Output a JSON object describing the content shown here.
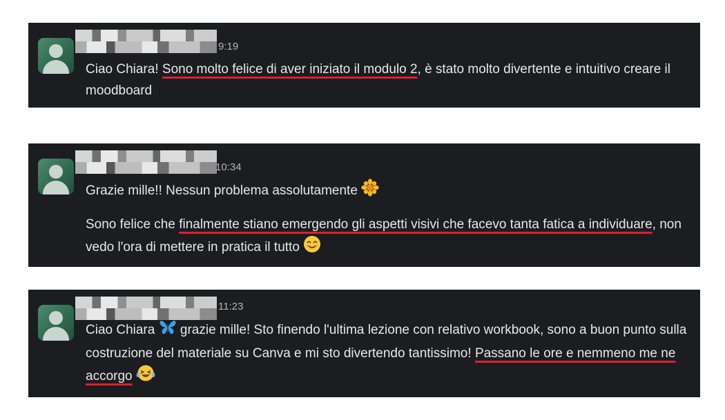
{
  "messages": [
    {
      "time": "9:19",
      "paragraphs": [
        {
          "before": "Ciao Chiara! ",
          "underlined": "Sono molto felice di aver iniziato il modulo 2",
          "after": ", è stato molto divertente e intuitivo creare il moodboard"
        }
      ]
    },
    {
      "time": "10:34",
      "paragraphs": [
        {
          "text": "Grazie mille!! Nessun problema assolutamente",
          "emoji": "flower-emoji"
        },
        {
          "before": "Sono felice che ",
          "underlined": "finalmente stiano emergendo gli aspetti visivi che facevo tanta fatica a individuare",
          "after": ", non vedo l'ora di mettere in pratica il tutto",
          "emoji": "smiling-face-emoji"
        }
      ]
    },
    {
      "time": "11:23",
      "paragraphs": [
        {
          "before": "Ciao Chiara",
          "emoji_inline": "butterfly-emoji",
          "middle": " grazie mille! Sto finendo l'ultima lezione con relativo workbook, sono a buon punto sulla costruzione del materiale su Canva e mi sto divertendo tantissimo! ",
          "underlined": "Passano le ore e nemmeno me ne accorgo",
          "emoji": "tears-of-joy-emoji"
        }
      ]
    }
  ],
  "colors": {
    "background": "#ffffff",
    "card": "#1b1d21",
    "text": "#e8e8e8",
    "timestamp": "#b5b5b5",
    "underline": "#e0202b"
  }
}
